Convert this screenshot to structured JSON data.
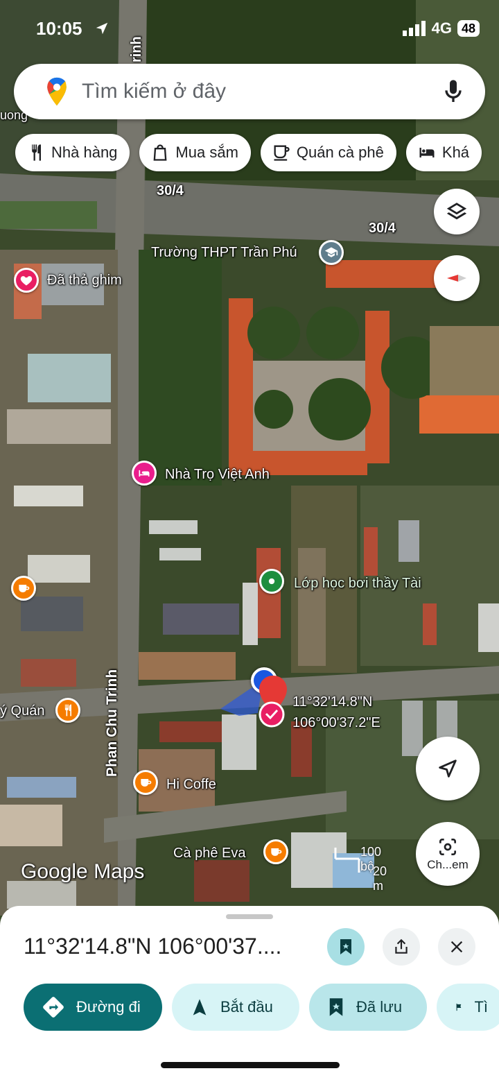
{
  "status_bar": {
    "time": "10:05",
    "network": "4G",
    "battery": "48"
  },
  "search": {
    "placeholder": "Tìm kiếm ở đây"
  },
  "chips": [
    {
      "label": "Nhà hàng",
      "icon": "fork-knife-icon"
    },
    {
      "label": "Mua sắm",
      "icon": "shopping-bag-icon"
    },
    {
      "label": "Quán cà phê",
      "icon": "coffee-cup-icon"
    },
    {
      "label": "Khá",
      "icon": "bed-icon"
    }
  ],
  "map": {
    "roads": {
      "road_30_4_a": "30/4",
      "road_30_4_b": "30/4",
      "road_pct": "Phan Chu Trinh",
      "road_top": "rinh"
    },
    "pois": {
      "school": "Trường THPT Trần Phú",
      "pinned": "Đã thả ghim",
      "motel": "Nhà Trọ Việt Anh",
      "swim": "Lớp học bơi thầy Tài",
      "restaurant": "ý Quán",
      "hi_coffe": "Hi Coffe",
      "eva": "Cà phê Eva",
      "left_edge": "uong"
    },
    "dropped_pin": {
      "lat": "11°32'14.8\"N",
      "lng": "106°00'37.2\"E"
    },
    "brand": "Google Maps",
    "scale": {
      "feet": "100 bộ",
      "meters": "20 m"
    },
    "camera_button": "Ch...em"
  },
  "sheet": {
    "title": "11°32'14.8\"N 106°00'37....",
    "buttons": {
      "directions": "Đường đi",
      "start": "Bắt đầu",
      "saved": "Đã lưu",
      "more": "Tì"
    }
  },
  "colors": {
    "teal": "#0b6f73",
    "light_teal": "#d7f4f6",
    "pin_red": "#e53935",
    "poi_orange": "#f57c00",
    "poi_pink": "#e91e8c",
    "poi_green": "#1e8e3e"
  }
}
